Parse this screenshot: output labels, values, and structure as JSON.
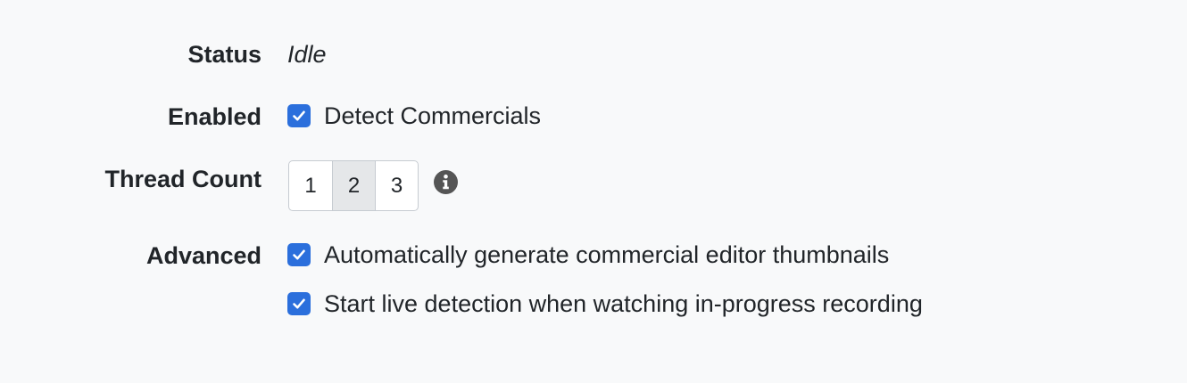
{
  "status": {
    "label": "Status",
    "value": "Idle"
  },
  "enabled": {
    "label": "Enabled",
    "checkbox_label": "Detect Commercials",
    "checked": true
  },
  "thread_count": {
    "label": "Thread Count",
    "options": [
      "1",
      "2",
      "3"
    ],
    "selected": "2",
    "info_icon": "info-circle-icon"
  },
  "advanced": {
    "label": "Advanced",
    "options": [
      {
        "label": "Automatically generate commercial editor thumbnails",
        "checked": true
      },
      {
        "label": "Start live detection when watching in-progress recording",
        "checked": true
      }
    ]
  },
  "colors": {
    "background": "#f8f9fa",
    "checkbox": "#2b6fdc",
    "text": "#212529",
    "selected_segment": "#e5e7e9",
    "icon": "#555555"
  }
}
